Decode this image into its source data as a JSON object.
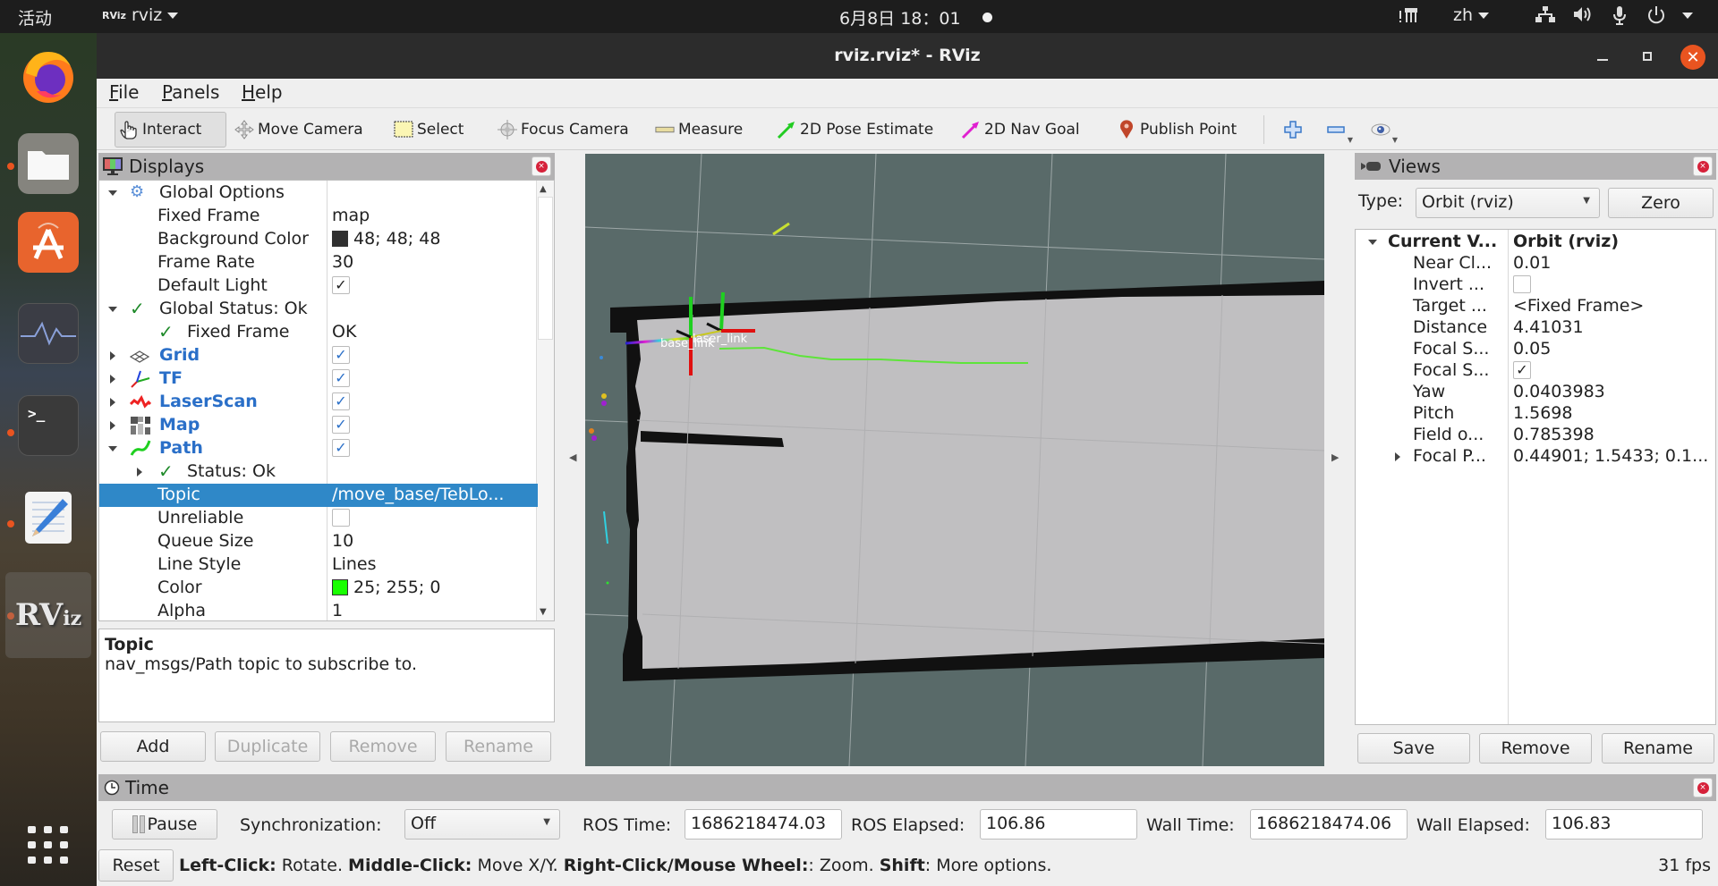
{
  "topbar": {
    "activities": "活动",
    "app_menu": "rviz",
    "clock": "6月8日  18：01",
    "input_method": "zh",
    "icons": [
      "indicator-icon",
      "network-icon",
      "volume-icon",
      "microphone-icon",
      "power-icon"
    ]
  },
  "dock": {
    "apps": [
      {
        "name": "Firefox",
        "icon": "firefox-icon",
        "running": false
      },
      {
        "name": "Files",
        "icon": "files-icon",
        "running": true
      },
      {
        "name": "Ubuntu Software",
        "icon": "software-icon",
        "running": false
      },
      {
        "name": "System Monitor",
        "icon": "system-monitor-icon",
        "running": false
      },
      {
        "name": "Terminal",
        "icon": "terminal-icon",
        "running": true
      },
      {
        "name": "Text Editor",
        "icon": "text-editor-icon",
        "running": true
      },
      {
        "name": "RViz",
        "icon": "rviz-icon",
        "running": true,
        "label": "RViz"
      }
    ],
    "show_apps": "show-apps-icon"
  },
  "window": {
    "title": "rviz.rviz* - RViz"
  },
  "menu": {
    "file": "File",
    "panels": "Panels",
    "help": "Help"
  },
  "toolbar": {
    "interact": "Interact",
    "move_camera": "Move Camera",
    "select": "Select",
    "focus_camera": "Focus Camera",
    "measure": "Measure",
    "pose_estimate": "2D Pose Estimate",
    "nav_goal": "2D Nav Goal",
    "publish_point": "Publish Point",
    "pose_color": "#22cc22",
    "nav_color": "#e020d0",
    "point_color": "#c0462a"
  },
  "displays": {
    "title": "Displays",
    "global_options": "Global Options",
    "fixed_frame_label": "Fixed Frame",
    "fixed_frame_value": "map",
    "bg_color_label": "Background Color",
    "bg_color_value": "48; 48; 48",
    "bg_color_hex": "#303030",
    "frame_rate_label": "Frame Rate",
    "frame_rate_value": "30",
    "default_light_label": "Default Light",
    "default_light_checked": true,
    "global_status": "Global Status: Ok",
    "status_fixed_frame_label": "Fixed Frame",
    "status_fixed_frame_value": "OK",
    "grid": "Grid",
    "tf": "TF",
    "laserscan": "LaserScan",
    "map": "Map",
    "path": "Path",
    "path_status": "Status: Ok",
    "topic_label": "Topic",
    "topic_value": "/move_base/TebLo...",
    "unreliable_label": "Unreliable",
    "queue_size_label": "Queue Size",
    "queue_size_value": "10",
    "line_style_label": "Line Style",
    "line_style_value": "Lines",
    "color_label": "Color",
    "color_value": "25; 255; 0",
    "color_hex": "#19ff00",
    "alpha_label": "Alpha",
    "alpha_value": "1",
    "desc_title": "Topic",
    "desc_text": "nav_msgs/Path topic to subscribe to.",
    "buttons": {
      "add": "Add",
      "duplicate": "Duplicate",
      "remove": "Remove",
      "rename": "Rename"
    }
  },
  "views": {
    "title": "Views",
    "type_label": "Type:",
    "type_value": "Orbit (rviz)",
    "zero": "Zero",
    "current_label": "Current V...",
    "current_value": "Orbit (rviz)",
    "props": [
      {
        "label": "Near Cl...",
        "value": "0.01"
      },
      {
        "label": "Invert ...",
        "value": "",
        "checkbox": false
      },
      {
        "label": "Target ...",
        "value": "<Fixed Frame>"
      },
      {
        "label": "Distance",
        "value": "4.41031"
      },
      {
        "label": "Focal S...",
        "value": "0.05"
      },
      {
        "label": "Focal S...",
        "value": "",
        "checkbox": true
      },
      {
        "label": "Yaw",
        "value": "0.0403983"
      },
      {
        "label": "Pitch",
        "value": "1.5698"
      },
      {
        "label": "Field o...",
        "value": "0.785398"
      },
      {
        "label": "Focal P...",
        "value": "0.44901; 1.5433; 0.1..."
      }
    ],
    "buttons": {
      "save": "Save",
      "remove": "Remove",
      "rename": "Rename"
    }
  },
  "time": {
    "title": "Time",
    "pause": "Pause",
    "sync_label": "Synchronization:",
    "sync_value": "Off",
    "ros_time_label": "ROS Time:",
    "ros_time_value": "1686218474.03",
    "ros_elapsed_label": "ROS Elapsed:",
    "ros_elapsed_value": "106.86",
    "wall_time_label": "Wall Time:",
    "wall_time_value": "1686218474.06",
    "wall_elapsed_label": "Wall Elapsed:",
    "wall_elapsed_value": "106.83"
  },
  "status": {
    "reset": "Reset",
    "left_click_key": "Left-Click:",
    "left_click_text": " Rotate. ",
    "middle_click_key": "Middle-Click:",
    "middle_click_text": " Move X/Y. ",
    "right_click_key": "Right-Click/Mouse Wheel:",
    "right_click_text": ": Zoom. ",
    "shift_key": "Shift",
    "shift_text": ": More options.",
    "fps": "31 fps"
  },
  "scene": {
    "tf_labels": [
      "base_link",
      "laser_link"
    ],
    "map_free_color": "#c0bfc1",
    "map_wall_color": "#111111",
    "grid_color": "#a9b2b2",
    "path_color": "#5ee43a"
  }
}
